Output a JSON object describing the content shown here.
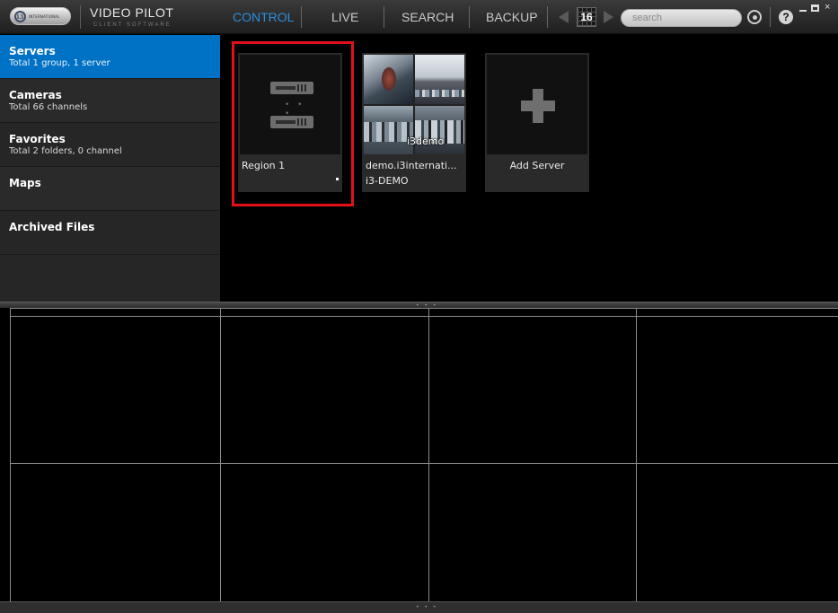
{
  "topbar": {
    "logo_company": "INTERNATIONAL",
    "app_title": "VIDEO PILOT",
    "app_subtitle": "CLIENT SOFTWARE",
    "tabs": [
      {
        "label": "CONTROL",
        "active": true
      },
      {
        "label": "LIVE",
        "active": false
      },
      {
        "label": "SEARCH",
        "active": false
      },
      {
        "label": "BACKUP",
        "active": false
      }
    ],
    "grid_count": "16",
    "search_placeholder": "search",
    "accent_color": "#2b8fde"
  },
  "sidebar": {
    "items": [
      {
        "title": "Servers",
        "subtitle": "Total 1 group, 1 server",
        "active": true
      },
      {
        "title": "Cameras",
        "subtitle": "Total 66 channels",
        "active": false
      },
      {
        "title": "Favorites",
        "subtitle": "Total 2 folders, 0 channel",
        "active": false
      },
      {
        "title": "Maps",
        "subtitle": "",
        "active": false
      },
      {
        "title": "Archived Files",
        "subtitle": "",
        "active": false
      }
    ],
    "active_color": "#0072c6"
  },
  "tiles": [
    {
      "name": "Region 1",
      "icon": "server-group-icon",
      "highlighted": true
    },
    {
      "name": "demo.i3internati...",
      "subname": "i3-DEMO",
      "thumbnail_caption": "i3demo"
    },
    {
      "name": "Add Server",
      "icon": "plus-icon"
    }
  ],
  "highlight_color": "#e3101b"
}
